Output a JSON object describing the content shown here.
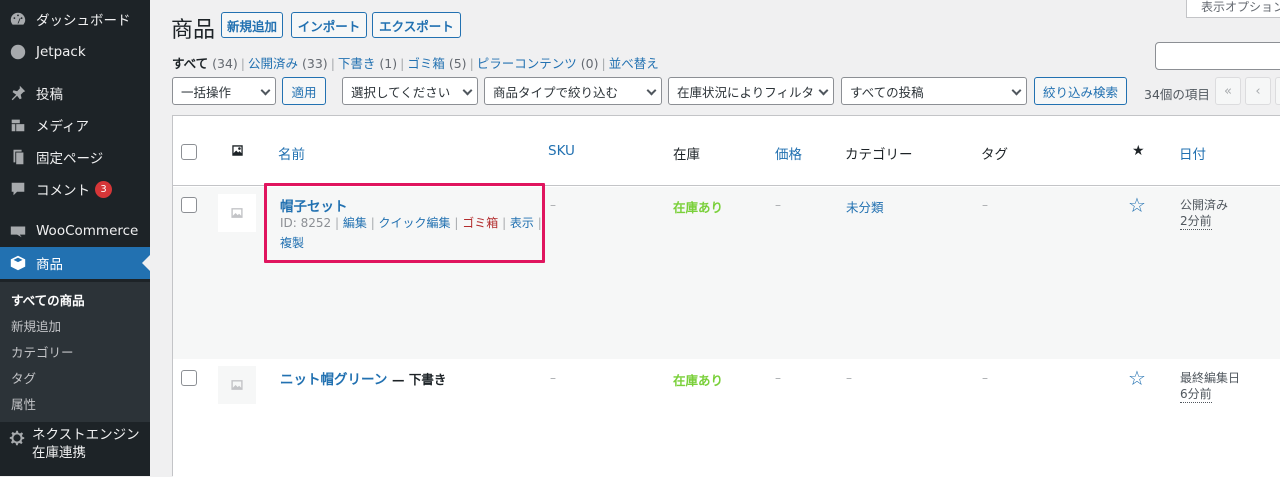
{
  "sidebar": {
    "items": [
      {
        "label": "ダッシュボード",
        "icon": "dashboard-icon"
      },
      {
        "label": "Jetpack",
        "icon": "jetpack-icon"
      },
      {
        "label": "投稿",
        "icon": "pin-icon"
      },
      {
        "label": "メディア",
        "icon": "media-icon"
      },
      {
        "label": "固定ページ",
        "icon": "page-icon"
      },
      {
        "label": "コメント",
        "icon": "comment-icon",
        "badge": "3"
      },
      {
        "label": "WooCommerce",
        "icon": "woo-icon"
      },
      {
        "label": "商品",
        "icon": "product-box-icon",
        "active": true
      }
    ],
    "submenu": [
      "すべての商品",
      "新規追加",
      "カテゴリー",
      "タグ",
      "属性"
    ],
    "next_engine_line1": "ネクストエンジン",
    "next_engine_line2": "在庫連携"
  },
  "page": {
    "title": "商品",
    "buttons": [
      "新規追加",
      "インポート",
      "エクスポート"
    ],
    "screen_options": "表示オプション"
  },
  "filters": {
    "all": {
      "label": "すべて",
      "count": "(34)"
    },
    "published": {
      "label": "公開済み",
      "count": "(33)"
    },
    "drafts": {
      "label": "下書き",
      "count": "(1)"
    },
    "trash": {
      "label": "ゴミ箱",
      "count": "(5)"
    },
    "pillar": {
      "label": "ピラーコンテンツ",
      "count": "(0)"
    },
    "sort": "並べ替え"
  },
  "toolbar": {
    "bulk_action": "一括操作",
    "apply": "適用",
    "category_select": "選択してください",
    "product_type": "商品タイプで絞り込む",
    "stock_status": "在庫状況によりフィルタ",
    "all_posts": "すべての投稿",
    "filter_button": "絞り込み検索",
    "items_count": "34個の項目",
    "first_page": "«",
    "prev_page": "‹"
  },
  "table": {
    "headers": {
      "name": "名前",
      "sku": "SKU",
      "stock": "在庫",
      "price": "価格",
      "category": "カテゴリー",
      "tags": "タグ",
      "date": "日付"
    },
    "rows": [
      {
        "name": "帽子セット",
        "id": "ID: 8252",
        "actions": [
          "編集",
          "クイック編集",
          "ゴミ箱",
          "表示",
          "複製"
        ],
        "sku": "–",
        "stock": "在庫あり",
        "price": "–",
        "category": "未分類",
        "tags": "–",
        "date_status": "公開済み",
        "date_rel": "2分前"
      },
      {
        "name": "ニット帽グリーン",
        "draft": "— 下書き",
        "sku": "–",
        "stock": "在庫あり",
        "price": "–",
        "category": "–",
        "tags": "–",
        "date_status": "最終編集日",
        "date_rel": "6分前"
      }
    ]
  },
  "colors": {
    "accent": "#2271b1",
    "sidebar": "#1d2327",
    "instock": "#7ad03a",
    "highlight": "#e0155e",
    "trash": "#b32d2e"
  }
}
